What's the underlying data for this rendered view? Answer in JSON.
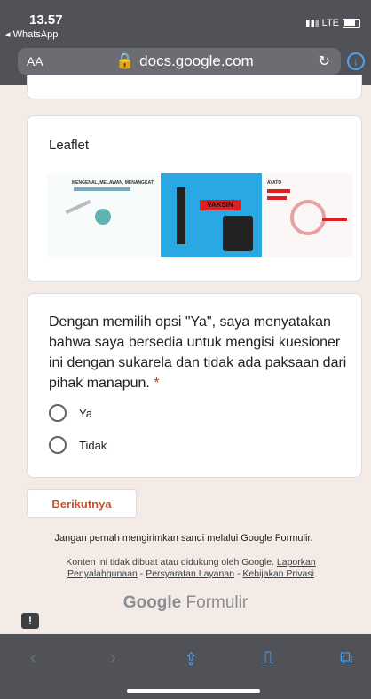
{
  "status": {
    "time": "13.57",
    "back_app": "◂ WhatsApp",
    "network": "LTE"
  },
  "browser": {
    "text_size": "AA",
    "url": "docs.google.com",
    "reload_icon": "reload-icon",
    "download_icon": "download-icon"
  },
  "form": {
    "leaflet_title": "Leaflet",
    "thumbs": [
      {
        "heading": "MENGENAL, MELAWAN, MENANGKAT"
      },
      {
        "heading": "VAKSIN"
      },
      {
        "heading": "AYATO"
      }
    ],
    "question": "Dengan memilih opsi \"Ya\", saya menyatakan bahwa saya bersedia untuk mengisi kuesioner ini dengan sukarela dan tidak ada paksaan dari pihak manapun.",
    "required_mark": "*",
    "options": [
      "Ya",
      "Tidak"
    ],
    "next_label": "Berikutnya",
    "warning": "Jangan pernah mengirimkan sandi melalui Google Formulir.",
    "disclaimer_text": "Konten ini tidak dibuat atau didukung oleh Google.",
    "links": [
      "Laporkan Penyalahgunaan",
      "Persyaratan Layanan",
      "Kebijakan Privasi"
    ],
    "brand_google": "Google",
    "brand_formulir": "Formulir",
    "report_glyph": "!"
  },
  "toolbar": {
    "back": "‹",
    "forward": "›",
    "share": "⇪",
    "bookmarks": "⎍",
    "tabs": "⧉"
  },
  "colors": {
    "accent": "#c5532c",
    "required": "#d93025",
    "browser_blue": "#4ea3f5"
  }
}
